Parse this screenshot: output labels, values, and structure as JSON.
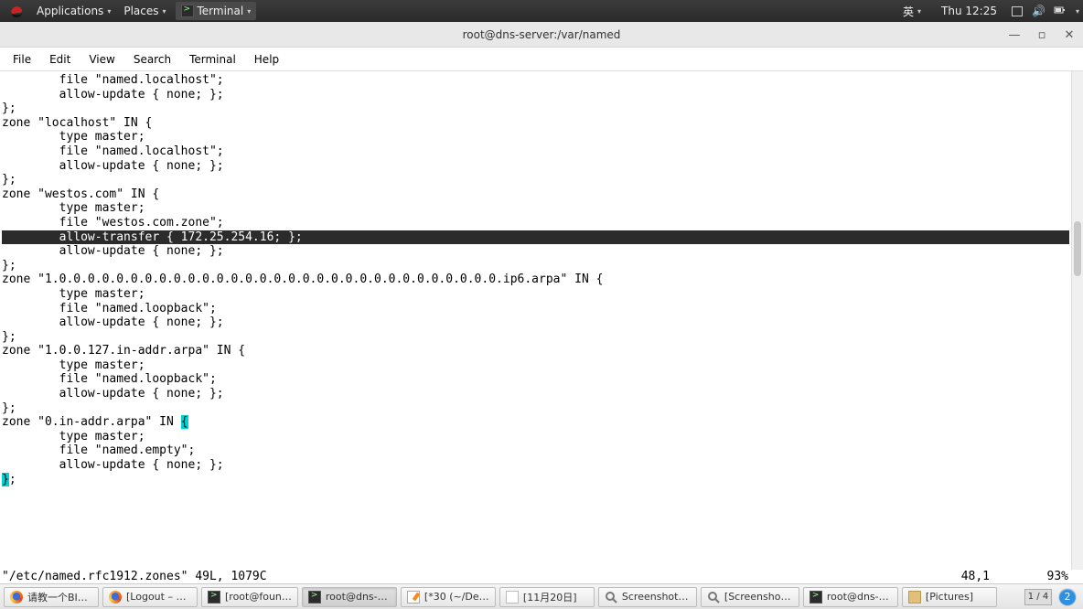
{
  "top_panel": {
    "applications": "Applications",
    "places": "Places",
    "running_app": "Terminal",
    "input_method": "英",
    "clock": "Thu 12:25"
  },
  "window": {
    "title": "root@dns-server:/var/named",
    "menubar": [
      "File",
      "Edit",
      "View",
      "Search",
      "Terminal",
      "Help"
    ]
  },
  "terminal": {
    "lines_pre": [
      "        file \"named.localhost\";",
      "        allow-update { none; };",
      "};",
      "",
      "zone \"localhost\" IN {",
      "        type master;",
      "        file \"named.localhost\";",
      "        allow-update { none; };",
      "};",
      "",
      "zone \"westos.com\" IN {",
      "        type master;",
      "        file \"westos.com.zone\";"
    ],
    "highlighted_line": "        allow-transfer { 172.25.254.16; };",
    "lines_mid": [
      "        allow-update { none; };",
      "};",
      "",
      "zone \"1.0.0.0.0.0.0.0.0.0.0.0.0.0.0.0.0.0.0.0.0.0.0.0.0.0.0.0.0.0.0.0.ip6.arpa\" IN {",
      "        type master;",
      "        file \"named.loopback\";",
      "        allow-update { none; };",
      "};",
      "",
      "zone \"1.0.0.127.in-addr.arpa\" IN {",
      "        type master;",
      "        file \"named.loopback\";",
      "        allow-update { none; };",
      "};",
      ""
    ],
    "cursor_line": {
      "prefix": "zone \"0.in-addr.arpa\" IN ",
      "cursor_char": "{"
    },
    "lines_post": [
      "        type master;",
      "        file \"named.empty\";",
      "        allow-update { none; };"
    ],
    "paren_match_line": {
      "match_char": "}",
      "suffix": ";"
    },
    "status": {
      "left": "\"/etc/named.rfc1912.zones\" 49L, 1079C",
      "pos": "48,1",
      "pct": "93%"
    }
  },
  "taskbar": {
    "items": [
      {
        "icon": "firefox",
        "label": "请教一个BI…"
      },
      {
        "icon": "firefox",
        "label": "[Logout – …"
      },
      {
        "icon": "terminal",
        "label": "[root@foun…"
      },
      {
        "icon": "terminal",
        "label": "root@dns-…",
        "active": true
      },
      {
        "icon": "gedit",
        "label": "[*30 (~/De…"
      },
      {
        "icon": "pdf",
        "label": "[11月20日]"
      },
      {
        "icon": "eog",
        "label": "Screenshot …"
      },
      {
        "icon": "eog",
        "label": "[Screenshot…"
      },
      {
        "icon": "terminal",
        "label": "root@dns-…"
      },
      {
        "icon": "folder",
        "label": "[Pictures]"
      }
    ],
    "pager": "1 / 4",
    "notification_badge": "2"
  }
}
